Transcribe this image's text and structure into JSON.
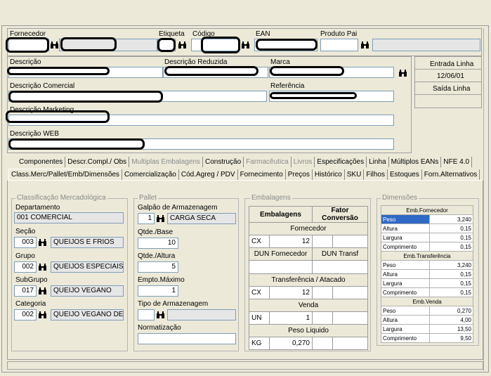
{
  "header": {
    "fornecedor_label": "Fornecedor",
    "etiqueta_label": "Etiqueta",
    "codigo_label": "Código",
    "ean_label": "EAN",
    "produto_pai_label": "Produto Pai"
  },
  "desc": {
    "descricao_label": "Descrição",
    "descricao_reduzida_label": "Descrição Reduzida",
    "marca_label": "Marca",
    "descricao_comercial_label": "Descrição Comercial",
    "referencia_label": "Referência",
    "descricao_marketing_label": "Descrição Marketing",
    "descricao_web_label": "Descrição WEB"
  },
  "side_box": {
    "entrada_linha_label": "Entrada Linha",
    "entrada_date": "12/06/01",
    "saida_linha_label": "Saída Linha"
  },
  "tabs_row1": [
    {
      "label": "Componentes",
      "disabled": false
    },
    {
      "label": "Descr.Compl./ Obs",
      "disabled": false
    },
    {
      "label": "Multiplas Embalagens",
      "disabled": true
    },
    {
      "label": "Construção",
      "disabled": false
    },
    {
      "label": "Farmacêutica",
      "disabled": true
    },
    {
      "label": "Livros",
      "disabled": true
    },
    {
      "label": "Especificações",
      "disabled": false
    },
    {
      "label": "Linha",
      "disabled": false
    },
    {
      "label": "Múltiplos EANs",
      "disabled": false
    },
    {
      "label": "NFE 4.0",
      "disabled": false
    }
  ],
  "tabs_row2": [
    {
      "label": "Class.Merc/Pallet/Emb/Dimensões",
      "active": true
    },
    {
      "label": "Comercialização"
    },
    {
      "label": "Cód.Agreg / PDV"
    },
    {
      "label": "Fornecimento"
    },
    {
      "label": "Preços"
    },
    {
      "label": "Histórico"
    },
    {
      "label": "SKU"
    },
    {
      "label": "Filhos"
    },
    {
      "label": "Estoques"
    },
    {
      "label": "Forn.Alternativos"
    }
  ],
  "classificacao": {
    "title": "Classificação Mercadológica",
    "departamento_label": "Departamento",
    "departamento_value": "001 COMERCIAL",
    "secao_label": "Seção",
    "secao_code": "003",
    "secao_name": "QUEIJOS E FRIOS",
    "grupo_label": "Grupo",
    "grupo_code": "002",
    "grupo_name": "QUEIJOS ESPECIAIS",
    "subgrupo_label": "SubGrupo",
    "subgrupo_code": "017",
    "subgrupo_name": "QUEIJO VEGANO",
    "categoria_label": "Categoria",
    "categoria_code": "002",
    "categoria_name": "QUEIJO VEGANO DE"
  },
  "pallet": {
    "title": "Pallet",
    "galpao_label": "Galpão de Armazenagem",
    "galpao_code": "1",
    "galpao_name": "CARGA SECA",
    "qtde_base_label": "Qtde./Base",
    "qtde_base_value": "10",
    "qtde_altura_label": "Qtde./Altura",
    "qtde_altura_value": "5",
    "empto_label": "Empto.Máximo",
    "empto_value": "1",
    "tipo_label": "Tipo de Armazenagem",
    "normatizacao_label": "Normatização"
  },
  "embalagens": {
    "title": "Embalagens",
    "col_embalagens": "Embalagens",
    "col_fator": "Fator Conversão",
    "fornecedor_header": "Fornecedor",
    "forn_unit": "CX",
    "forn_qty": "12",
    "dun_fornecedor": "DUN Fornecedor",
    "dun_transf": "DUN Transf",
    "transf_header": "Transferência / Atacado",
    "transf_unit": "CX",
    "transf_qty": "12",
    "venda_header": "Venda",
    "venda_unit": "UN",
    "venda_qty": "1",
    "peso_liquido_header": "Peso Liquido",
    "peso_unit": "KG",
    "peso_value": "0,270"
  },
  "dimensoes": {
    "title": "Dimensões",
    "sections": [
      {
        "header": "Emb.Fornecedor",
        "rows": [
          {
            "label": "Peso",
            "value": "3,240",
            "highlight": true
          },
          {
            "label": "Altura",
            "value": "0,15"
          },
          {
            "label": "Largura",
            "value": "0,15"
          },
          {
            "label": "Comprimento",
            "value": "0,15"
          }
        ]
      },
      {
        "header": "Emb.Transferência",
        "rows": [
          {
            "label": "Peso",
            "value": "3,240"
          },
          {
            "label": "Altura",
            "value": "0,15"
          },
          {
            "label": "Largura",
            "value": "0,15"
          },
          {
            "label": "Comprimento",
            "value": "0,15"
          }
        ]
      },
      {
        "header": "Emb.Venda",
        "rows": [
          {
            "label": "Peso",
            "value": "0,270"
          },
          {
            "label": "Altura",
            "value": "4,00"
          },
          {
            "label": "Largura",
            "value": "13,50"
          },
          {
            "label": "Comprimento",
            "value": "9,50"
          }
        ]
      }
    ]
  },
  "colors": {
    "background": "#ece9d8",
    "highlight": "#3169c6",
    "field_border": "#7f9db9"
  }
}
